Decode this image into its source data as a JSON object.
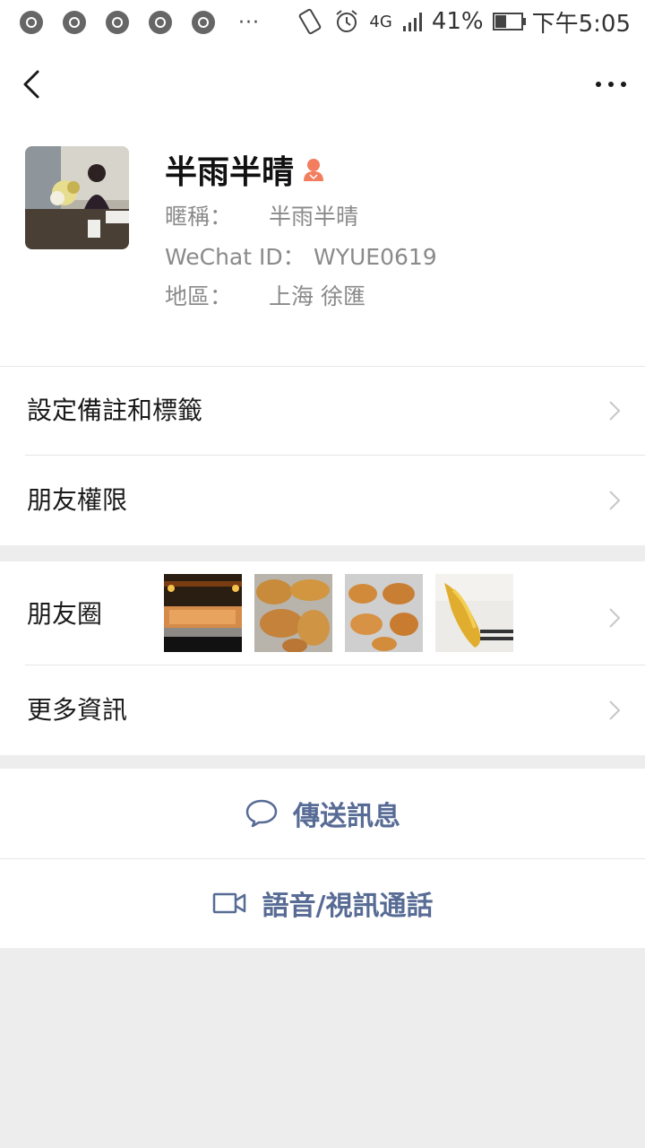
{
  "status_bar": {
    "icons": [
      "chrome-icon",
      "chrome-icon",
      "chrome-icon",
      "chrome-icon",
      "chrome-icon"
    ],
    "overflow": "···",
    "network": "4G",
    "battery": "41%",
    "time": "下午5:05"
  },
  "nav": {
    "back_icon": "chevron-left-icon",
    "more_icon": "more-dots-icon"
  },
  "profile": {
    "name": "半雨半晴",
    "gender_icon": "female-icon",
    "nickname_label": "暱稱：",
    "nickname_value": "半雨半晴",
    "wechat_id_label": "WeChat ID：",
    "wechat_id_value": "WYUE0619",
    "region_label": "地區：",
    "region_value": "上海  徐匯"
  },
  "cells": {
    "remarks_label": "設定備註和標籤",
    "permissions_label": "朋友權限",
    "moments_label": "朋友圈",
    "more_info_label": "更多資訊"
  },
  "actions": {
    "send_message": "傳送訊息",
    "voice_video_call": "語音/視訊通話"
  },
  "colors": {
    "accent_link": "#576b95",
    "background": "#ededed",
    "female_icon": "#f37e5f"
  }
}
